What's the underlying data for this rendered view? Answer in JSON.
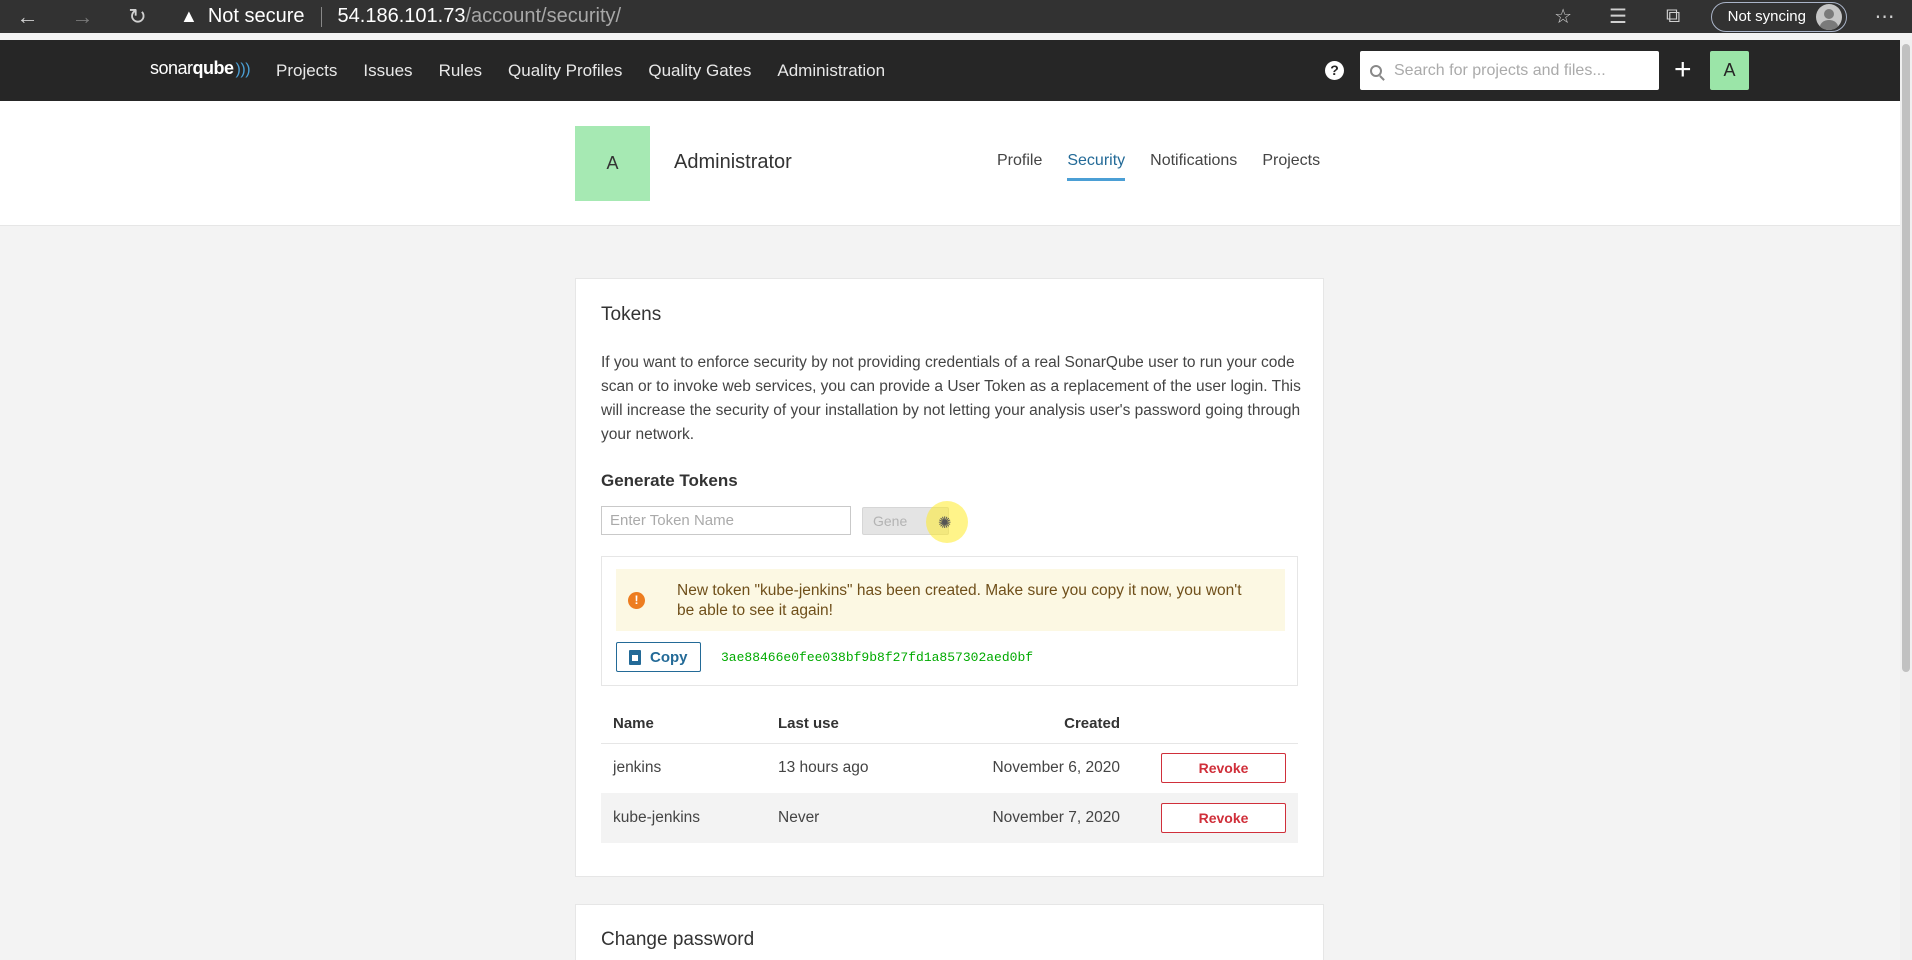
{
  "browser": {
    "security_label": "Not secure",
    "url_host": "54.186.101.73",
    "url_path": "/account/security/",
    "sync_label": "Not syncing"
  },
  "nav": {
    "logo_text_a": "sonar",
    "logo_text_b": "qube",
    "items": [
      "Projects",
      "Issues",
      "Rules",
      "Quality Profiles",
      "Quality Gates",
      "Administration"
    ],
    "help": "?",
    "search_placeholder": "Search for projects and files...",
    "plus": "+",
    "avatar_letter": "A"
  },
  "account": {
    "avatar_letter": "A",
    "name": "Administrator",
    "tabs": [
      "Profile",
      "Security",
      "Notifications",
      "Projects"
    ],
    "active_tab": "Security"
  },
  "tokens": {
    "title": "Tokens",
    "description": "If you want to enforce security by not providing credentials of a real SonarQube user to run your code scan or to invoke web services, you can provide a User Token as a replacement of the user login. This will increase the security of your installation by not letting your analysis user's password going through your network.",
    "generate_title": "Generate Tokens",
    "input_placeholder": "Enter Token Name",
    "generate_button": "Gene",
    "alert_text": "New token \"kube-jenkins\" has been created. Make sure you copy it now, you won't be able to see it again!",
    "copy_button": "Copy",
    "token_value": "3ae88466e0fee038bf9b8f27fd1a857302aed0bf",
    "columns": [
      "Name",
      "Last use",
      "Created",
      ""
    ],
    "rows": [
      {
        "name": "jenkins",
        "last_use": "13 hours ago",
        "created": "November 6, 2020",
        "action": "Revoke"
      },
      {
        "name": "kube-jenkins",
        "last_use": "Never",
        "created": "November 7, 2020",
        "action": "Revoke"
      }
    ]
  },
  "change_password": {
    "title": "Change password"
  }
}
